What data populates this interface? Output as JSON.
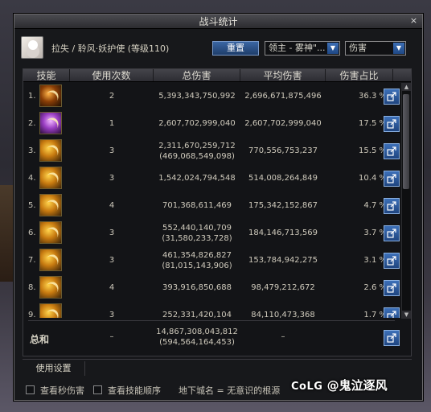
{
  "window": {
    "title": "战斗统计",
    "close_icon": "×"
  },
  "header": {
    "character": "拉失 / 聆风·妖护使 (等级110)",
    "reset_label": "重置",
    "boss_select": "领主 - 雾神\"...",
    "metric_select": "伤害"
  },
  "table": {
    "columns": [
      "技能",
      "使用次数",
      "总伤害",
      "平均伤害",
      "伤害占比"
    ],
    "rows": [
      {
        "index": "1.",
        "icon": "skill-icon",
        "uses": "2",
        "damage": "5,393,343,750,992",
        "damage_extra": "",
        "avg": "2,696,671,875,496",
        "pct": "36.3  %"
      },
      {
        "index": "2.",
        "icon": "skill-icon",
        "uses": "1",
        "damage": "2,607,702,999,040",
        "damage_extra": "",
        "avg": "2,607,702,999,040",
        "pct": "17.5  %"
      },
      {
        "index": "3.",
        "icon": "skill-icon",
        "uses": "3",
        "damage": "2,311,670,259,712",
        "damage_extra": "(469,068,549,098)",
        "avg": "770,556,753,237",
        "pct": "15.5  %"
      },
      {
        "index": "4.",
        "icon": "skill-icon",
        "uses": "3",
        "damage": "1,542,024,794,548",
        "damage_extra": "",
        "avg": "514,008,264,849",
        "pct": "10.4  %"
      },
      {
        "index": "5.",
        "icon": "skill-icon",
        "uses": "4",
        "damage": "701,368,611,469",
        "damage_extra": "",
        "avg": "175,342,152,867",
        "pct": "4.7  %"
      },
      {
        "index": "6.",
        "icon": "skill-icon",
        "uses": "3",
        "damage": "552,440,140,709",
        "damage_extra": "(31,580,233,728)",
        "avg": "184,146,713,569",
        "pct": "3.7  %"
      },
      {
        "index": "7.",
        "icon": "skill-icon",
        "uses": "3",
        "damage": "461,354,826,827",
        "damage_extra": "(81,015,143,906)",
        "avg": "153,784,942,275",
        "pct": "3.1  %"
      },
      {
        "index": "8.",
        "icon": "skill-icon",
        "uses": "4",
        "damage": "393,916,850,688",
        "damage_extra": "",
        "avg": "98,479,212,672",
        "pct": "2.6  %"
      },
      {
        "index": "9.",
        "icon": "skill-icon",
        "uses": "3",
        "damage": "252,331,420,104",
        "damage_extra": "",
        "avg": "84,110,473,368",
        "pct": "1.7  %"
      }
    ],
    "total": {
      "label": "总和",
      "uses": "–",
      "damage": "14,867,308,043,812",
      "damage_extra": "(594,564,164,453)",
      "avg": "–"
    }
  },
  "settings": {
    "tab_label": "使用设置"
  },
  "footer": {
    "check_dps": "查看秒伤害",
    "check_order": "查看技能顺序",
    "dungeon": "地下城名 = 无意识的根源"
  },
  "watermark": {
    "logo": "CoLG",
    "handle": "@鬼泣逐风"
  },
  "colors": {
    "window_bg": "#17181b",
    "accent_blue": "#1f4580",
    "text": "#cfcabc"
  }
}
